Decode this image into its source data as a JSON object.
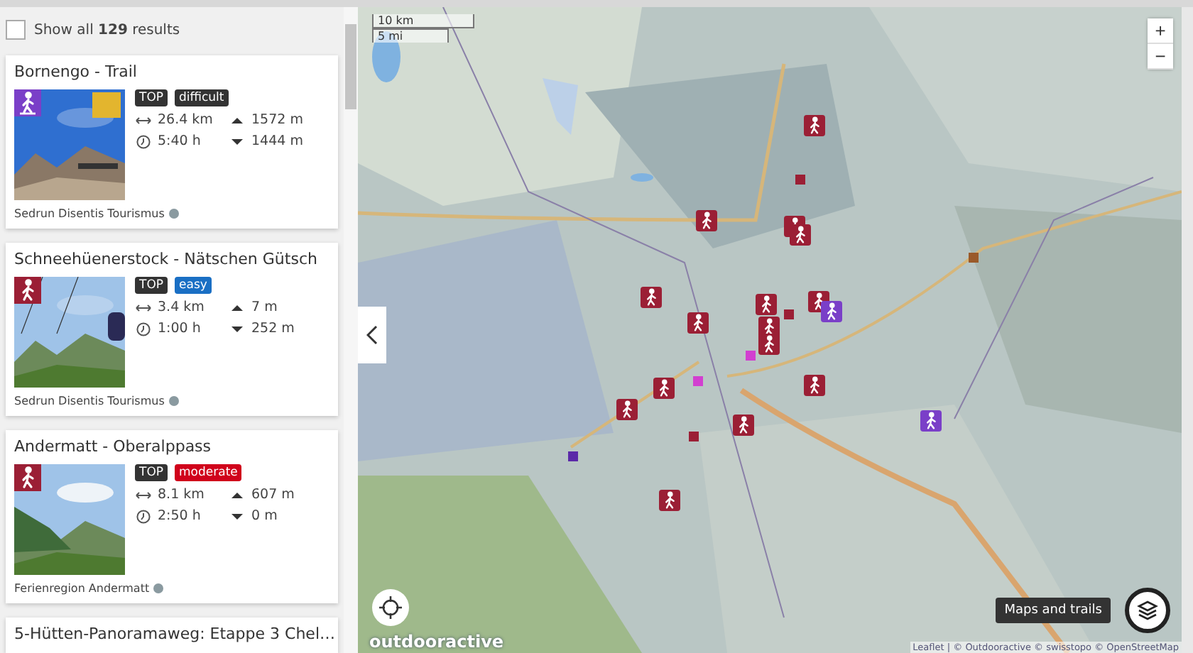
{
  "results_filter": {
    "label": "Show all **129** results",
    "checked": false
  },
  "tours": [
    {
      "title": "Bornengo - Trail",
      "kind": "snowshoe",
      "tags": [
        {
          "text": "TOP",
          "kind": "top"
        },
        {
          "text": "difficult",
          "kind": "difficult"
        }
      ],
      "distance": "26.4 km",
      "duration": "5:40 h",
      "ascent": "1572 m",
      "descent": "1444 m",
      "source": "Sedrun Disentis Tourismus"
    },
    {
      "title": "Schneehüenerstock - Nätschen Gütsch",
      "kind": "hiking",
      "tags": [
        {
          "text": "TOP",
          "kind": "top"
        },
        {
          "text": "easy",
          "kind": "easy"
        }
      ],
      "distance": "3.4 km",
      "duration": "1:00 h",
      "ascent": "7 m",
      "descent": "252 m",
      "source": "Sedrun Disentis Tourismus"
    },
    {
      "title": "Andermatt - Oberalppass",
      "kind": "hiking",
      "tags": [
        {
          "text": "TOP",
          "kind": "top"
        },
        {
          "text": "moderate",
          "kind": "moderate"
        }
      ],
      "distance": "8.1 km",
      "duration": "2:50 h",
      "ascent": "607 m",
      "descent": "0 m",
      "source": "Ferienregion Andermatt"
    },
    {
      "title": "5-Hütten-Panoramaweg: Etappe 3 Chel…"
    }
  ],
  "map": {
    "scale": [
      "10 km",
      "5 mi"
    ],
    "zoom_in": "+",
    "zoom_out": "−",
    "logo": "outdooractive",
    "layers_tooltip": "Maps and trails",
    "attribution": "Leaflet | © Outdooractive © swisstopo © OpenStreetMap"
  }
}
